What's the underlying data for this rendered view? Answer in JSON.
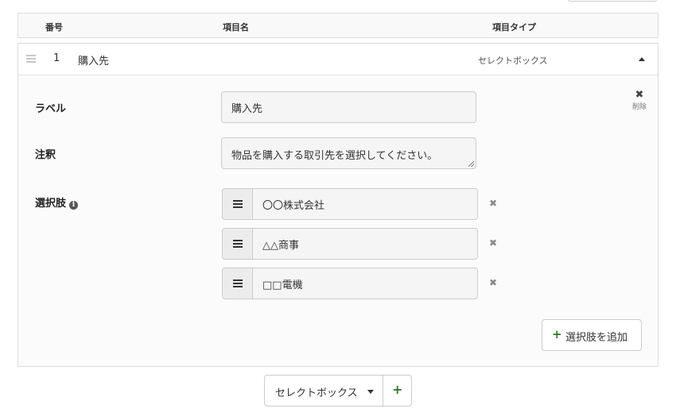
{
  "table_header": {
    "col_number": "番号",
    "col_name": "項目名",
    "col_type": "項目タイプ"
  },
  "item": {
    "number": "1",
    "name": "購入先",
    "type": "セレクトボックス"
  },
  "fields": {
    "label_label": "ラベル",
    "label_value": "購入先",
    "note_label": "注釈",
    "note_value": "物品を購入する取引先を選択してください。",
    "choices_label": "選択肢",
    "remove_label": "削除"
  },
  "choices": [
    {
      "text": "〇〇株式会社"
    },
    {
      "text": "△△商事"
    },
    {
      "text": "□□電機"
    }
  ],
  "buttons": {
    "add_choice": "選択肢を追加",
    "type_select": "セレクトボックス"
  },
  "colors": {
    "accent_green": "#2e7d32",
    "border": "#cccccc"
  },
  "icons": {
    "drag": "drag-handle-icon",
    "collapse": "chevron-up-icon",
    "remove": "close-icon",
    "info": "info-circle-icon",
    "add": "plus-icon",
    "dropdown": "caret-down-icon"
  }
}
